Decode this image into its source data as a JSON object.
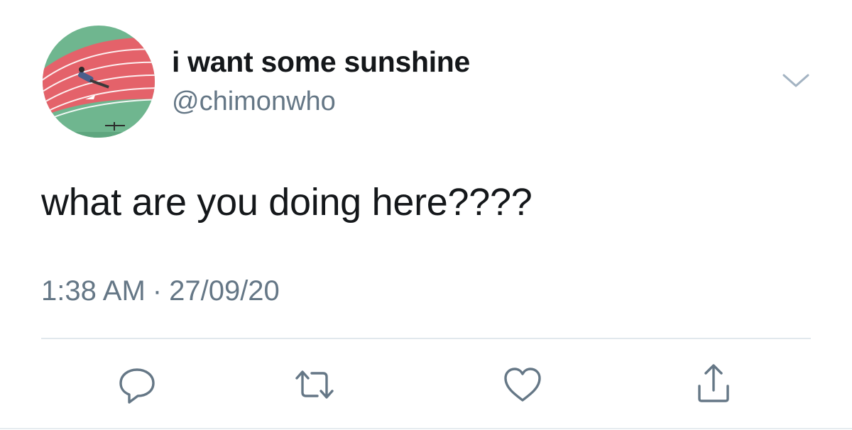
{
  "tweet": {
    "display_name": "i want some sunshine",
    "handle": "@chimonwho",
    "text": "what are you doing here????",
    "time": "1:38 AM",
    "separator": "·",
    "date": "27/09/20"
  },
  "icons": {
    "menu": "chevron-down-icon",
    "reply": "speech-bubble-icon",
    "retweet": "retweet-arrows-icon",
    "like": "heart-icon",
    "share": "share-upload-icon"
  },
  "colors": {
    "text_primary": "#14171a",
    "text_secondary": "#657786",
    "icon": "#657786",
    "divider": "#e1e8ed",
    "avatar_track": "#e4626a",
    "avatar_field": "#6fb68f"
  }
}
